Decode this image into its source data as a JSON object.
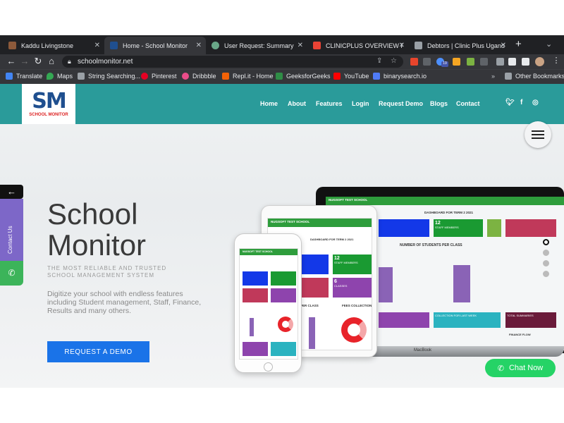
{
  "browser": {
    "tabs": [
      {
        "title": "Kaddu Livingstone",
        "active": false
      },
      {
        "title": "Home - School Monitor",
        "active": true
      },
      {
        "title": "User Request: Summary",
        "active": false
      },
      {
        "title": "CLINICPLUS OVERVIEW FOR",
        "active": false
      },
      {
        "title": "Debtors | Clinic Plus Uganda",
        "active": false
      }
    ],
    "url": "schoolmonitor.net",
    "extension_badge": "19",
    "bookmarks": [
      "Translate",
      "Maps",
      "String Searching...",
      "Pinterest",
      "Dribbble",
      "Repl.it - Home",
      "GeeksforGeeks",
      "YouTube",
      "binarysearch.io"
    ],
    "other_bookmarks": "Other Bookmarks"
  },
  "site": {
    "logo": {
      "mark": "SM",
      "text": "SCHOOL MONITOR"
    },
    "nav": [
      "Home",
      "About",
      "Features",
      "Login",
      "Request Demo",
      "Blogs",
      "Contact"
    ],
    "social_icons": [
      "twitter-icon",
      "facebook-icon",
      "instagram-icon"
    ],
    "side_contact_label": "Contact Us",
    "hero": {
      "title_line1": "School",
      "title_line2": "Monitor",
      "subtitle": "THE MOST RELIABLE AND TRUSTED SCHOOL MANAGEMENT SYSTEM",
      "description": "Digitize your school with endless features including Student management, Staff, Finance, Results and many others.",
      "cta": "REQUEST A DEMO"
    },
    "chat_label": "Chat Now",
    "mockup": {
      "school_name": "NUGSOFT TEST SCHOOL",
      "dashboard_title": "DASHBOARD FOR TERM 2 2021",
      "chart_students": "NUMBER OF STUDENTS PER CLASS",
      "students_per_class": "PER CLASS",
      "fees_collection": "FEES COLLECTION",
      "staff_members": "STAFF MEMBERS",
      "staff_count": "12",
      "classes_count": "6",
      "classes_label": "CLASSES",
      "laptop_brand": "MacBook",
      "finance_flow": "FINANCE FLOW",
      "total_summaries": "TOTAL SUMMARIES",
      "collection_label": "COLLECTION FOR LAST WEEK"
    }
  },
  "colors": {
    "teal": "#2a9b9a",
    "cta": "#1a73e8",
    "whatsapp": "#25d366",
    "contact_tab": "#7d67c8"
  }
}
